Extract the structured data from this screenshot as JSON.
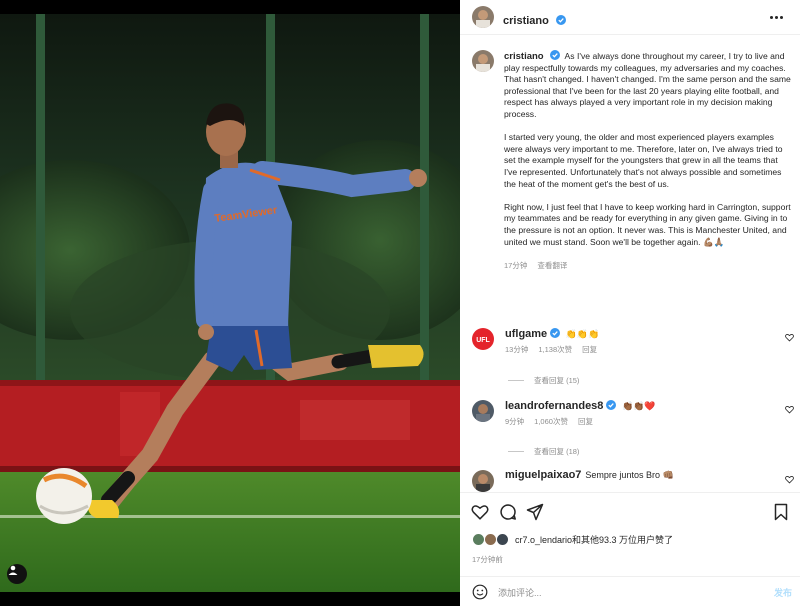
{
  "post": {
    "author": "cristiano",
    "caption_paragraphs": [
      "As I've always done throughout my career, I try to live and play respectfully towards my colleagues, my adversaries and my coaches. That hasn't changed. I haven't changed. I'm the same person and the same professional that I've been for the last 20 years playing elite football, and respect has always played a very important role in my decision making process.",
      "I started very young, the older and most experienced players examples were always very important to me. Therefore, later on, I've always tried to set the example myself for the youngsters that grew in all the teams that I've represented. Unfortunately that's not always possible and sometimes the heat of the moment get's the best of us.",
      "Right now, I just feel that I have to keep working hard in Carrington, support my teammates and be ready for everything in any given game. Giving in to the pressure is not an option. It never was. This is Manchester United, and united we must stand. Soon we'll be together again. 💪🏽🙏🏽"
    ],
    "caption_time": "17分钟",
    "see_translation": "查看翻译",
    "jersey_text": "TeamViewer",
    "liked_by": "cr7.o_lendario和其他93.3 万位用户赞了",
    "post_time": "17分钟前",
    "add_comment_placeholder": "添加评论...",
    "post_button": "发布"
  },
  "comments": [
    {
      "user": "uflgame",
      "text": "👏👏👏",
      "time": "13分钟",
      "likes": "1,138次赞",
      "reply": "回复",
      "view_replies": "查看回复 (15)"
    },
    {
      "user": "leandrofernandes8",
      "text": "👏🏾👏🏾❤️",
      "time": "9分钟",
      "likes": "1,060次赞",
      "reply": "回复",
      "view_replies": "查看回复 (18)"
    },
    {
      "user": "miguelpaixao7",
      "text": "Sempre juntos Bro 👊🏽"
    }
  ],
  "icons": [
    "user-tag-icon",
    "more-icon",
    "verified-icon",
    "heart-icon",
    "comment-icon",
    "share-icon",
    "bookmark-icon",
    "emoji-icon"
  ],
  "colors": {
    "verified": "#3897f0",
    "like_heart": "#ed4956",
    "jersey": "#5d7ec0",
    "post_disabled": "#b2dffc"
  }
}
